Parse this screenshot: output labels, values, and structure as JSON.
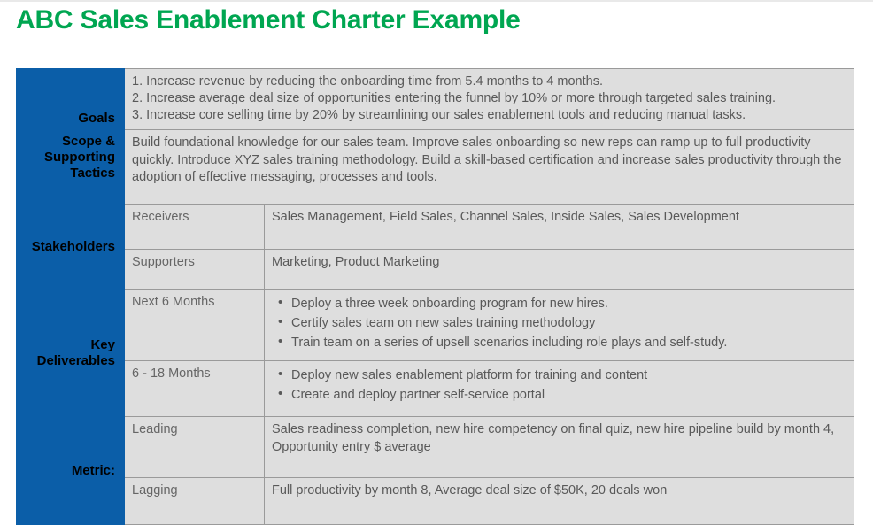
{
  "title": "ABC Sales Enablement Charter Example",
  "colors": {
    "title_green": "#00a651",
    "label_blue": "#0b5ea8",
    "cell_gray": "#dedede",
    "text_gray": "#595959",
    "border_gray": "#9a9a9a"
  },
  "table": {
    "goals": {
      "label": "Goals",
      "items": [
        "1. Increase revenue by reducing the onboarding time from 5.4 months to 4 months.",
        "2. Increase average deal size of opportunities entering the funnel by 10% or more through targeted sales training.",
        "3. Increase core selling time by 20% by streamlining our sales enablement tools and reducing manual tasks."
      ]
    },
    "scope": {
      "label_line1": "Scope &",
      "label_line2": "Supporting",
      "label_line3": "Tactics",
      "text": "Build foundational knowledge for our sales team. Improve sales onboarding so new reps can ramp up to full productivity quickly.  Introduce XYZ sales training methodology. Build a skill-based certification and increase sales productivity through the adoption of effective messaging, processes and tools."
    },
    "stakeholders": {
      "label": "Stakeholders",
      "rows": [
        {
          "sub": "Receivers",
          "text": "Sales Management, Field Sales, Channel Sales, Inside Sales, Sales Development"
        },
        {
          "sub": "Supporters",
          "text": "Marketing, Product Marketing"
        }
      ]
    },
    "deliverables": {
      "label_line1": "Key",
      "label_line2": "Deliverables",
      "rows": [
        {
          "sub": "Next 6 Months",
          "bullets": [
            "Deploy a three week onboarding program for new hires.",
            "Certify sales team on new sales training methodology",
            "Train team on a series of upsell scenarios including role plays and self-study."
          ]
        },
        {
          "sub": "6 - 18 Months",
          "bullets": [
            "Deploy new sales enablement platform for training and content",
            "Create and deploy partner self-service portal"
          ]
        }
      ]
    },
    "metric": {
      "label": "Metric:",
      "rows": [
        {
          "sub": "Leading",
          "text": "Sales readiness completion, new hire competency on final quiz, new hire pipeline build by month 4, Opportunity entry $ average"
        },
        {
          "sub": "Lagging",
          "text": "Full productivity by month 8, Average deal size of $50K, 20 deals won"
        }
      ]
    }
  }
}
